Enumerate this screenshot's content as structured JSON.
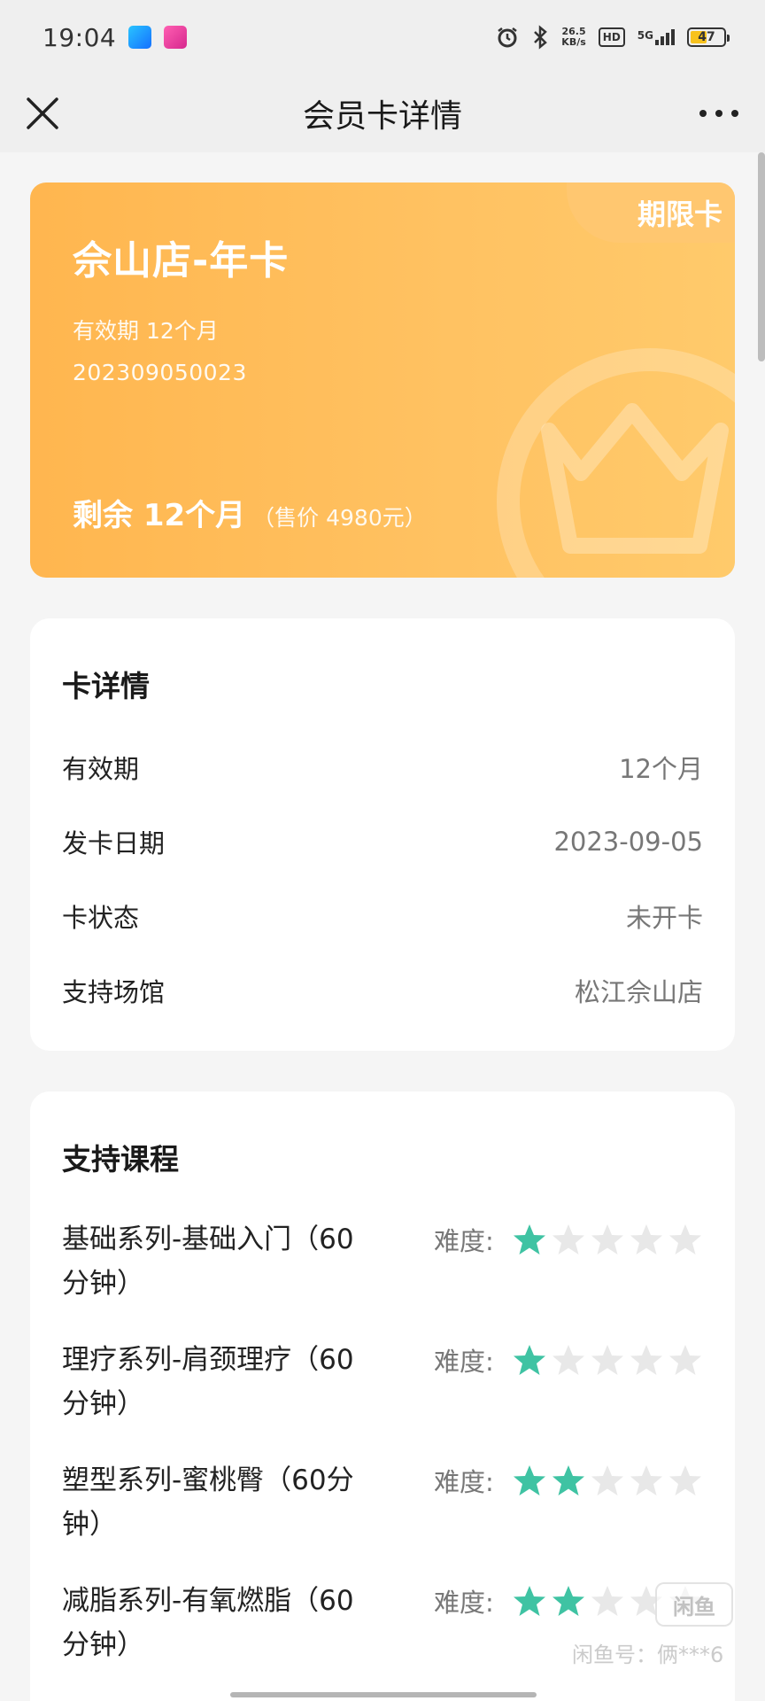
{
  "status_bar": {
    "time": "19:04",
    "net_speed": "26.5",
    "net_unit": "KB/s",
    "hd": "HD",
    "signal": "5G",
    "battery": "47",
    "battery_level": 0.47
  },
  "nav": {
    "title": "会员卡详情",
    "close_icon": "close-icon",
    "more_icon": "more-icon"
  },
  "card": {
    "type_badge": "期限卡",
    "name": "佘山店-年卡",
    "validity": "有效期 12个月",
    "number": "202309050023",
    "remaining": "剩余 12个月",
    "price": "（售价 4980元）",
    "gradient_start": "#ffb64f",
    "gradient_end": "#ffca6b"
  },
  "details": {
    "title": "卡详情",
    "rows": [
      {
        "label": "有效期",
        "value": "12个月"
      },
      {
        "label": "发卡日期",
        "value": "2023-09-05"
      },
      {
        "label": "卡状态",
        "value": "未开卡"
      },
      {
        "label": "支持场馆",
        "value": "松江佘山店"
      }
    ]
  },
  "courses": {
    "title": "支持课程",
    "difficulty_label": "难度:",
    "star_color": "#3fc3a3",
    "star_empty_color": "#e8e8e8",
    "items": [
      {
        "line1": "基础系列-基础入门（60",
        "line2": "分钟）",
        "stars": 1,
        "max": 5
      },
      {
        "line1": "理疗系列-肩颈理疗（60",
        "line2": "分钟）",
        "stars": 1,
        "max": 5
      },
      {
        "line1": "塑型系列-蜜桃臀（60分",
        "line2": "钟）",
        "stars": 2,
        "max": 5
      },
      {
        "line1": "减脂系列-有氧燃脂（60",
        "line2": "分钟）",
        "stars": 2,
        "max": 5
      }
    ]
  },
  "watermark": {
    "logo": "闲鱼",
    "text": "闲鱼号：俩***6"
  }
}
